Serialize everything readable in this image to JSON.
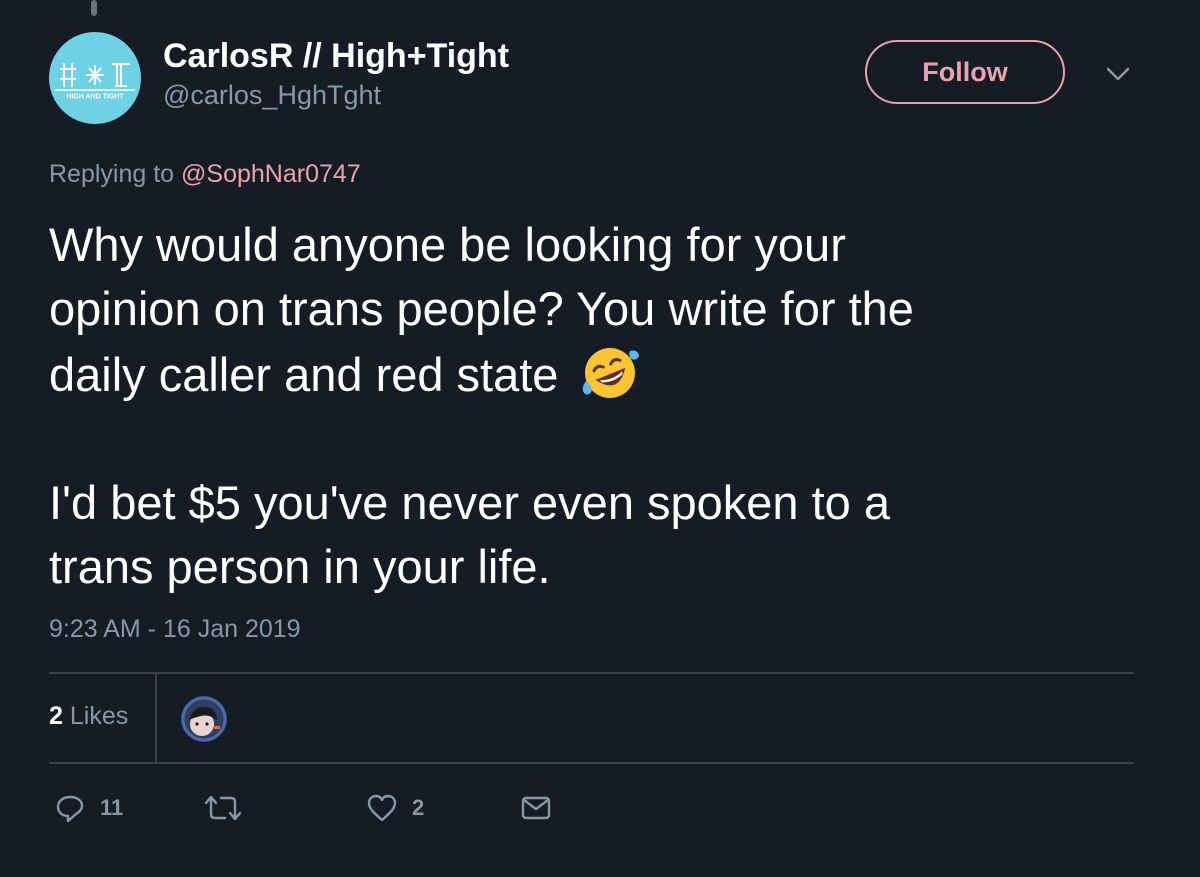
{
  "author": {
    "display_name": "CarlosR // High+Tight",
    "handle": "@carlos_HghTght",
    "avatar_text": "HIGH AND TIGHT"
  },
  "follow_label": "Follow",
  "reply_context": {
    "prefix": "Replying to",
    "mention": "@SophNar0747"
  },
  "tweet": {
    "paragraph1_lines": [
      "Why would anyone be looking for your",
      "opinion on trans people? You write for the",
      "daily caller and red state"
    ],
    "paragraph2_lines": [
      "I'd bet $5 you've never even spoken to a",
      "trans person in your life."
    ],
    "emoji": "rolling-on-floor-laughing-emoji"
  },
  "timestamp": "9:23 AM - 16 Jan 2019",
  "stats": {
    "likes_count": "2",
    "likes_label": "Likes"
  },
  "actions": {
    "reply_count": "11",
    "retweet_count": "",
    "like_count": "2"
  },
  "colors": {
    "background": "#151c25",
    "accent": "#e9a3ad",
    "secondary_text": "#8899a6",
    "divider": "#38444d",
    "avatar_bg": "#6fd2e4"
  },
  "icons": {
    "reply": "reply-icon",
    "retweet": "retweet-icon",
    "like": "heart-icon",
    "dm": "envelope-icon",
    "more": "chevron-down-icon"
  }
}
